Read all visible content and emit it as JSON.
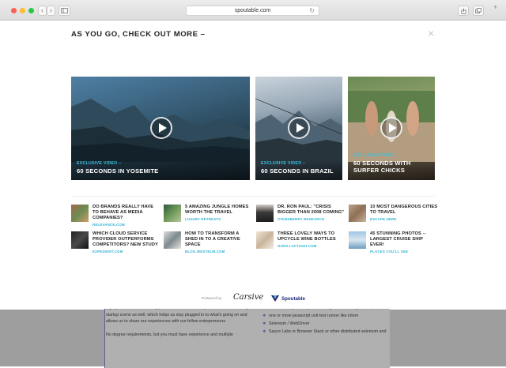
{
  "browser": {
    "url": "spoutable.com",
    "nav_back": "‹",
    "nav_forward": "›",
    "new_tab": "+"
  },
  "modal": {
    "title": "AS YOU GO, CHECK OUT MORE –",
    "close": "×"
  },
  "videos": [
    {
      "tag": "EXCLUSIVE VIDEO –",
      "title": "60 SECONDS IN YOSEMITE"
    },
    {
      "tag": "EXCLUSIVE VIDEO –",
      "title": "60 SECONDS IN BRAZIL"
    },
    {
      "tag": "EXCLUSIVE VIDEO –",
      "title": "60 SECONDS WITH SURFER CHICKS"
    }
  ],
  "links": [
    {
      "title": "DO BRANDS REALLY HAVE TO BEHAVE AS MEDIA COMPANIES?",
      "source": "RELEVANCE.COM"
    },
    {
      "title": "5 AMAZING JUNGLE HOMES WORTH THE TRAVEL",
      "source": "LUXURY RETREATS"
    },
    {
      "title": "DR. RON PAUL: \"CRISIS BIGGER THAN 2008 COMING\"",
      "source": "STANSBERRY RESEARCH"
    },
    {
      "title": "10 MOST DANGEROUS CITIES TO TRAVEL",
      "source": "ESCAPE HERE"
    },
    {
      "title": "WHICH CLOUD SERVICE PROVIDER OUTPERFORMS COMPETITORS? NEW STUDY",
      "source": "EXPEDIENT.COM"
    },
    {
      "title": "HOW TO TRANSFORM A SHED IN TO A CREATIVE SPACE",
      "source": "BLOG.WESTELM.COM"
    },
    {
      "title": "THREE LOVELY WAYS TO UPCYCLE WINE BOTTLES",
      "source": "GOES.LAFTUGH.COM"
    },
    {
      "title": "45 STUNNING PHOTOS -- LARGEST CRUISE SHIP EVER!",
      "source": "PLACES YOU'LL SEE"
    }
  ],
  "footer": {
    "powered_by": "Powered by",
    "partner": "Carsive",
    "brand": "Spoutable"
  },
  "background_page": {
    "left_paragraphs": [
      "highly selective in our hiring process. Our team is very active in the San Diego startup scene as well, which helps us stay plugged in to what's going on and allows us to share our experiences with our fellow entrepreneurs.",
      "No degree requirements, but you must have experience and multiple"
    ],
    "right_items": [
      "one or more javascript unit testing libraries like, jasmine, karma etc...",
      "one or more javascript unit test runner like intern",
      "Selenium / WebDriver",
      "Sauce Labs or Browser Stack or other distributed selenium and"
    ]
  },
  "colors": {
    "accent": "#36c2e0",
    "brand": "#1f2a7a",
    "overlay": "#9e9e9e"
  }
}
